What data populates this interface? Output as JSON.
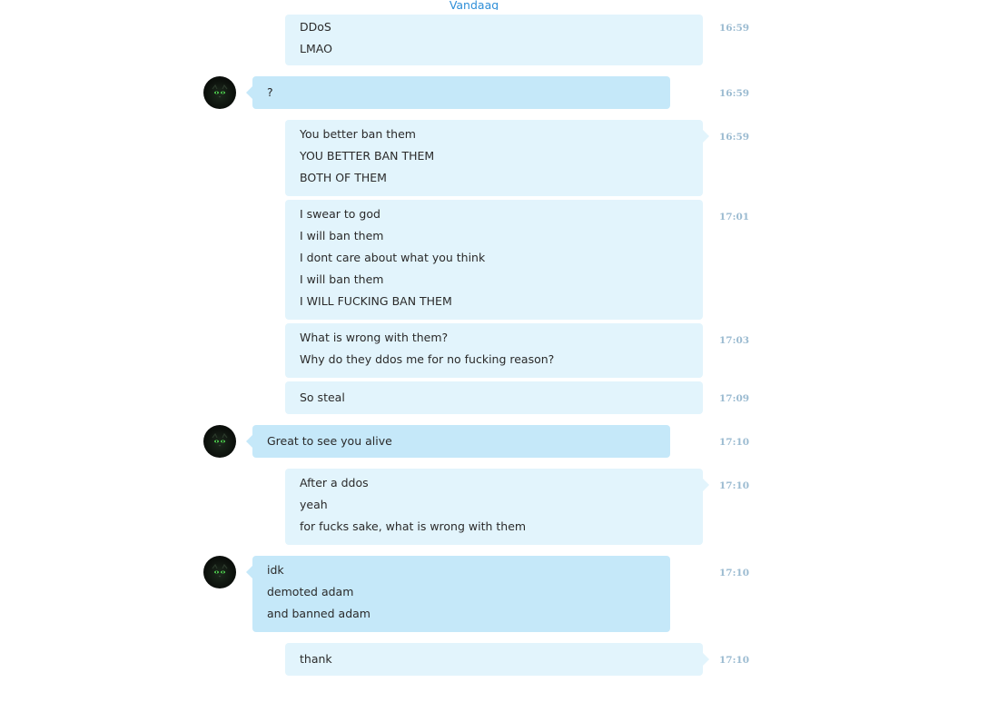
{
  "date_separator": "Vandaag",
  "messages": [
    {
      "from": "self",
      "time": "16:59",
      "lines": [
        "DDoS",
        "LMAO"
      ]
    },
    {
      "from": "other",
      "time": "16:59",
      "lines": [
        "?"
      ]
    },
    {
      "from": "self",
      "time": "16:59",
      "lines": [
        "You better ban them",
        "YOU BETTER BAN THEM",
        "BOTH OF THEM"
      ]
    },
    {
      "from": "self",
      "time": "17:01",
      "lines": [
        "I swear to god",
        "I will ban them",
        "I dont care about what you think",
        "I will ban them",
        "I WILL FUCKING BAN THEM"
      ]
    },
    {
      "from": "self",
      "time": "17:03",
      "lines": [
        "What is wrong with them?",
        "Why do they ddos me for no fucking reason?"
      ]
    },
    {
      "from": "self",
      "time": "17:09",
      "lines": [
        "So steal"
      ]
    },
    {
      "from": "other",
      "time": "17:10",
      "lines": [
        "Great to see you alive"
      ]
    },
    {
      "from": "self",
      "time": "17:10",
      "lines": [
        "After a ddos",
        "yeah",
        "for fucks sake, what is wrong with them"
      ]
    },
    {
      "from": "other",
      "time": "17:10",
      "lines": [
        "idk",
        "demoted adam",
        "and banned adam"
      ]
    },
    {
      "from": "self",
      "time": "17:10",
      "lines": [
        "thank"
      ]
    }
  ],
  "colors": {
    "incoming_bubble": "#c5e8f9",
    "outgoing_bubble": "#e2f4fc",
    "timestamp": "#9bbbd1",
    "date_separator": "#2f8fd8"
  },
  "icons": {
    "avatar": "cat-eyes-avatar-icon"
  }
}
